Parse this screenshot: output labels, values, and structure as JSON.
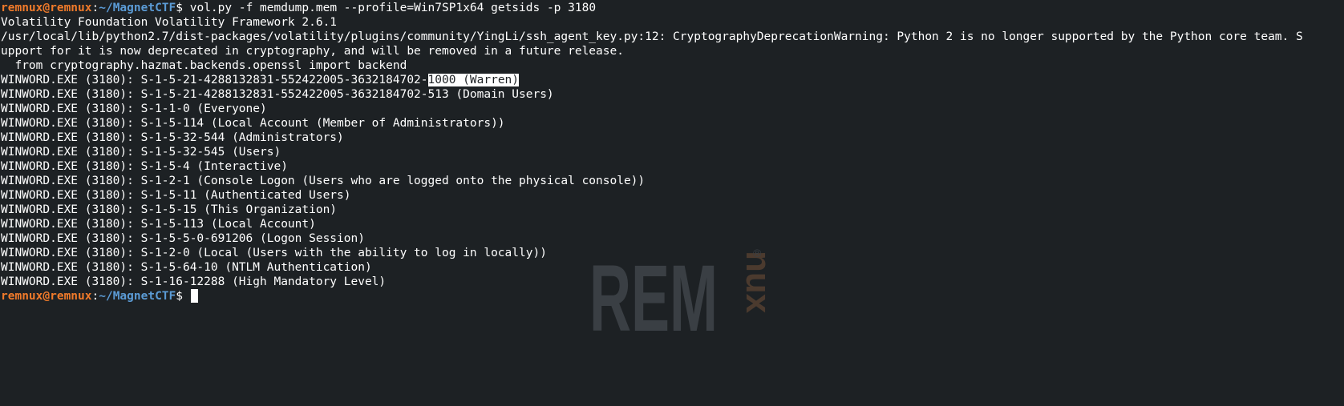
{
  "prompt": {
    "user_host": "remnux@remnux",
    "separator": ":",
    "path": "~/MagnetCTF",
    "symbol": "$ "
  },
  "command": "vol.py -f memdump.mem --profile=Win7SP1x64 getsids -p 3180",
  "header_lines": [
    "Volatility Foundation Volatility Framework 2.6.1",
    "/usr/local/lib/python2.7/dist-packages/volatility/plugins/community/YingLi/ssh_agent_key.py:12: CryptographyDeprecationWarning: Python 2 is no longer supported by the Python core team. S",
    "upport for it is now deprecated in cryptography, and will be removed in a future release.",
    "  from cryptography.hazmat.backends.openssl import backend"
  ],
  "first_sid": {
    "prefix": "WINWORD.EXE (3180): S-1-5-21-4288132831-552422005-3632184702-",
    "highlighted": "1000 (Warren)"
  },
  "sid_lines": [
    "WINWORD.EXE (3180): S-1-5-21-4288132831-552422005-3632184702-513 (Domain Users)",
    "WINWORD.EXE (3180): S-1-1-0 (Everyone)",
    "WINWORD.EXE (3180): S-1-5-114 (Local Account (Member of Administrators))",
    "WINWORD.EXE (3180): S-1-5-32-544 (Administrators)",
    "WINWORD.EXE (3180): S-1-5-32-545 (Users)",
    "WINWORD.EXE (3180): S-1-5-4 (Interactive)",
    "WINWORD.EXE (3180): S-1-2-1 (Console Logon (Users who are logged onto the physical console))",
    "WINWORD.EXE (3180): S-1-5-11 (Authenticated Users)",
    "WINWORD.EXE (3180): S-1-5-15 (This Organization)",
    "WINWORD.EXE (3180): S-1-5-113 (Local Account)",
    "WINWORD.EXE (3180): S-1-5-5-0-691206 (Logon Session)",
    "WINWORD.EXE (3180): S-1-2-0 (Local (Users with the ability to log in locally))",
    "WINWORD.EXE (3180): S-1-5-64-10 (NTLM Authentication)",
    "WINWORD.EXE (3180): S-1-16-12288 (High Mandatory Level)"
  ],
  "watermark": {
    "main": "REM",
    "side": "nux",
    "mark": "®"
  },
  "colors": {
    "background": "#1d2124",
    "prompt_user": "#f07a2a",
    "prompt_path": "#5b9bd5",
    "text": "#ffffff"
  }
}
